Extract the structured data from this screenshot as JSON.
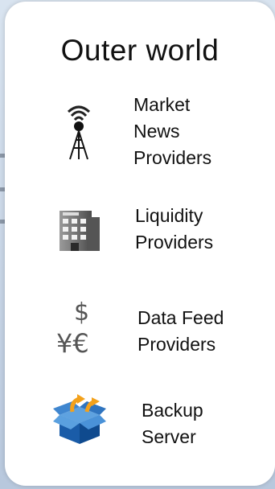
{
  "title": "Outer world",
  "items": [
    {
      "name": "market-news-providers",
      "icon": "radio-tower-icon",
      "lines": [
        "Market",
        "News",
        "Providers"
      ]
    },
    {
      "name": "liquidity-providers",
      "icon": "office-building-icon",
      "lines": [
        "Liquidity",
        "Providers"
      ]
    },
    {
      "name": "data-feed-providers",
      "icon": "currency-symbols-icon",
      "lines": [
        "Data Feed",
        "Providers"
      ],
      "icon_text": [
        "$",
        "¥€"
      ]
    },
    {
      "name": "backup-server",
      "icon": "open-box-icon",
      "lines": [
        "Backup",
        "Server"
      ]
    }
  ]
}
